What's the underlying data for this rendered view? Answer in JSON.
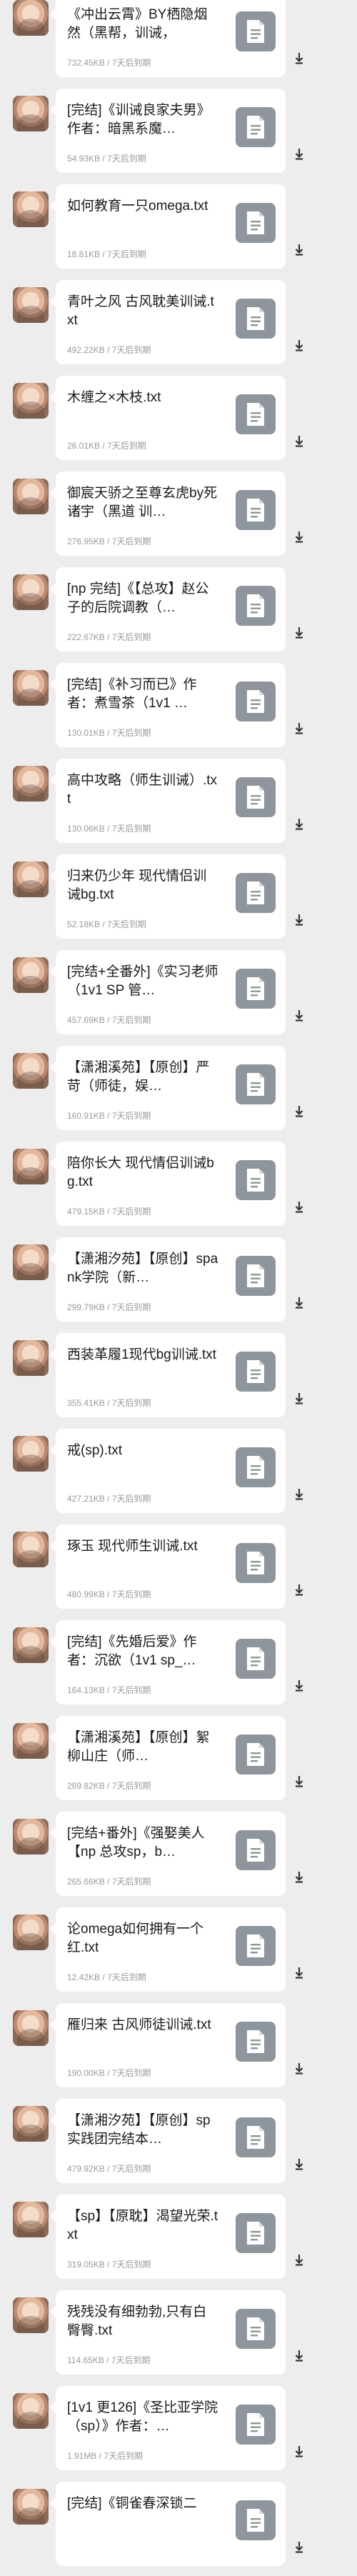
{
  "expiry": "7天后到期",
  "messages": [
    {
      "name": "《冲出云霄》BY栖隐烟然（黑帮，训诫，",
      "size": "732.45KB"
    },
    {
      "name": "[完结]《训诫良家夫男》作者：暗黑系魔…",
      "size": "54.93KB"
    },
    {
      "name": "如何教育一只omega.txt",
      "size": "18.81KB"
    },
    {
      "name": "青叶之风 古风耽美训诫.txt",
      "size": "492.22KB"
    },
    {
      "name": "木缠之×木枝.txt",
      "size": "26.01KB"
    },
    {
      "name": "御宸天骄之至尊玄虎by死诸宇（黑道 训…",
      "size": "276.95KB"
    },
    {
      "name": "[np 完结]《【总攻】赵公子的后院调教（…",
      "size": "222.67KB"
    },
    {
      "name": "[完结]《补习而已》作者：煮雪茶（1v1 …",
      "size": "130.01KB"
    },
    {
      "name": "高中攻略（师生训诫）.txt",
      "size": "130.06KB"
    },
    {
      "name": "归来仍少年 现代情侣训诫bg.txt",
      "size": "52.18KB"
    },
    {
      "name": "[完结+全番外]《实习老师（1v1 SP 管…",
      "size": "457.69KB"
    },
    {
      "name": "【潇湘溪苑】【原创】严苛（师徒，娱…",
      "size": "160.91KB"
    },
    {
      "name": "陪你长大 现代情侣训诫bg.txt",
      "size": "479.15KB"
    },
    {
      "name": "【潇湘汐苑】【原创】spank学院（新…",
      "size": "299.79KB"
    },
    {
      "name": "西装革履1现代bg训诫.txt",
      "size": "355.41KB"
    },
    {
      "name": "戒(sp).txt",
      "size": "427.21KB"
    },
    {
      "name": "琢玉 现代师生训诫.txt",
      "size": "480.99KB"
    },
    {
      "name": "[完结]《先婚后爱》作者：沉欲（1v1 sp_…",
      "size": "164.13KB"
    },
    {
      "name": "【潇湘溪苑】【原创】絮柳山庄（师…",
      "size": "289.82KB"
    },
    {
      "name": "[完结+番外]《强娶美人【np 总攻sp，b…",
      "size": "265.66KB"
    },
    {
      "name": "论omega如何拥有一个红.txt",
      "size": "12.42KB"
    },
    {
      "name": "雁归来 古风师徒训诫.txt",
      "size": "190.00KB"
    },
    {
      "name": "【潇湘汐苑】【原创】sp实践团完结本…",
      "size": "479.92KB"
    },
    {
      "name": "【sp】【原耽】渴望光荣.txt",
      "size": "319.05KB"
    },
    {
      "name": "残残没有细勃勃,只有白臀臀.txt",
      "size": "114.65KB"
    },
    {
      "name": "[1v1 更126]《圣比亚学院（sp）》作者：…",
      "size": "1.91MB"
    },
    {
      "name": "[完结]《铜雀春深锁二",
      "size": ""
    }
  ]
}
